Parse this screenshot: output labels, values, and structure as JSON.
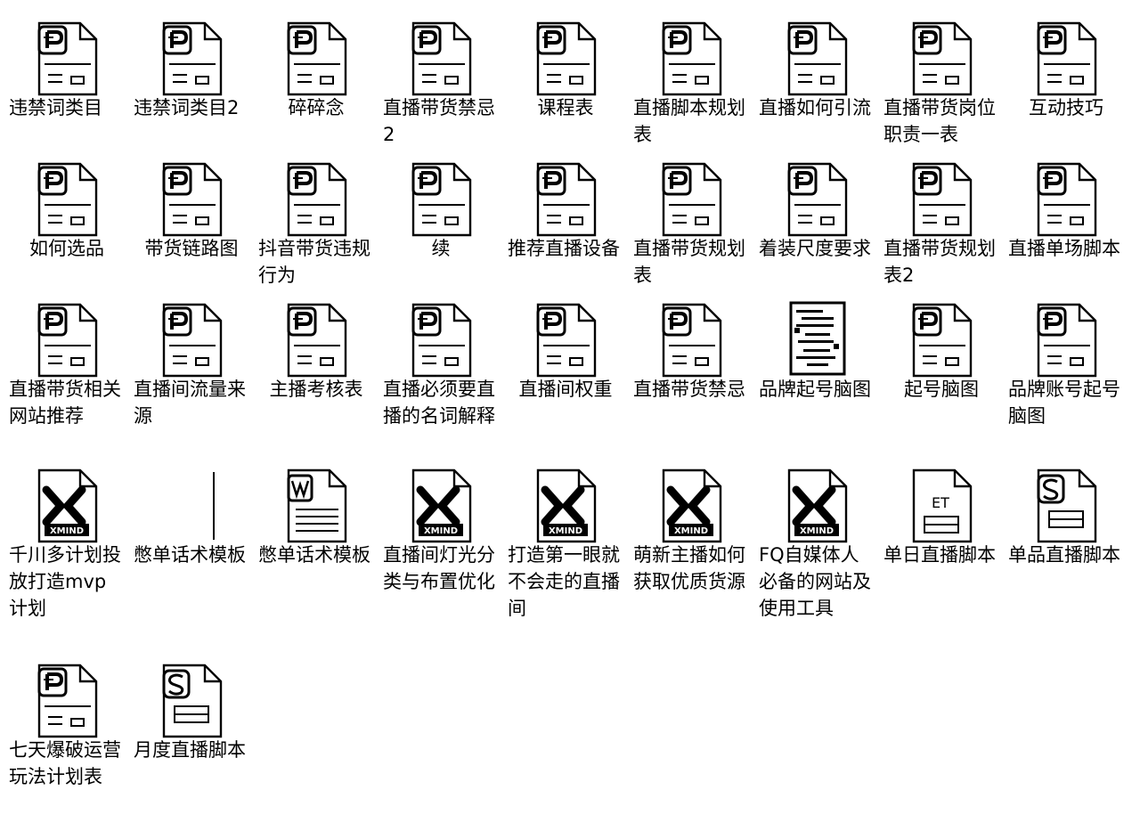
{
  "files": [
    {
      "name": "违禁词类目",
      "type": "pdf",
      "align": "left"
    },
    {
      "name": "违禁词类目2",
      "type": "pdf",
      "align": "left"
    },
    {
      "name": "碎碎念",
      "type": "pdf",
      "align": "center"
    },
    {
      "name": "直播带货禁忌2",
      "type": "pdf",
      "align": "left"
    },
    {
      "name": "课程表",
      "type": "pdf",
      "align": "center"
    },
    {
      "name": "直播脚本规划表",
      "type": "pdf",
      "align": "left"
    },
    {
      "name": "直播如何引流",
      "type": "pdf",
      "align": "left"
    },
    {
      "name": "直播带货岗位职责一表",
      "type": "pdf",
      "align": "left"
    },
    {
      "name": "互动技巧",
      "type": "pdf",
      "align": "center"
    },
    {
      "name": "如何选品",
      "type": "pdf",
      "align": "center"
    },
    {
      "name": "带货链路图",
      "type": "pdf",
      "align": "center"
    },
    {
      "name": "抖音带货违规行为",
      "type": "pdf",
      "align": "left"
    },
    {
      "name": "续",
      "type": "pdf",
      "align": "center"
    },
    {
      "name": "推荐直播设备",
      "type": "pdf",
      "align": "left"
    },
    {
      "name": "直播带货规划表",
      "type": "pdf",
      "align": "left"
    },
    {
      "name": "着装尺度要求",
      "type": "pdf",
      "align": "left"
    },
    {
      "name": "直播带货规划表2",
      "type": "pdf",
      "align": "left"
    },
    {
      "name": "直播单场脚本",
      "type": "pdf",
      "align": "left"
    },
    {
      "name": "直播带货相关网站推荐",
      "type": "pdf",
      "align": "left"
    },
    {
      "name": "直播间流量来源",
      "type": "pdf",
      "align": "left"
    },
    {
      "name": "主播考核表",
      "type": "pdf",
      "align": "center"
    },
    {
      "name": "直播必须要直播的名词解释",
      "type": "pdf",
      "align": "left"
    },
    {
      "name": "直播间权重",
      "type": "pdf",
      "align": "center"
    },
    {
      "name": "直播带货禁忌",
      "type": "pdf",
      "align": "left"
    },
    {
      "name": "品牌起号脑图",
      "type": "image",
      "align": "left"
    },
    {
      "name": "起号脑图",
      "type": "pdf",
      "align": "center"
    },
    {
      "name": "品牌账号起号脑图",
      "type": "pdf",
      "align": "left"
    },
    {
      "name": "千川多计划投放打造mvp计划",
      "type": "xmind",
      "align": "left"
    },
    {
      "name": "憋单话术模板",
      "type": "blank",
      "align": "left"
    },
    {
      "name": "憋单话术模板",
      "type": "word",
      "align": "left"
    },
    {
      "name": "直播间灯光分类与布置优化",
      "type": "xmind",
      "align": "left"
    },
    {
      "name": "打造第一眼就不会走的直播间",
      "type": "xmind",
      "align": "left"
    },
    {
      "name": "萌新主播如何获取优质货源",
      "type": "xmind",
      "align": "left"
    },
    {
      "name": "FQ自媒体人必备的网站及使用工具",
      "type": "xmind",
      "align": "left"
    },
    {
      "name": "单日直播脚本",
      "type": "et",
      "align": "left"
    },
    {
      "name": "单品直播脚本",
      "type": "wps",
      "align": "left"
    },
    {
      "name": "七天爆破运营玩法计划表",
      "type": "pdf",
      "align": "left"
    },
    {
      "name": "月度直播脚本",
      "type": "wps",
      "align": "left"
    }
  ],
  "icon_text": {
    "et": "ET",
    "xmind": "XMIND"
  }
}
